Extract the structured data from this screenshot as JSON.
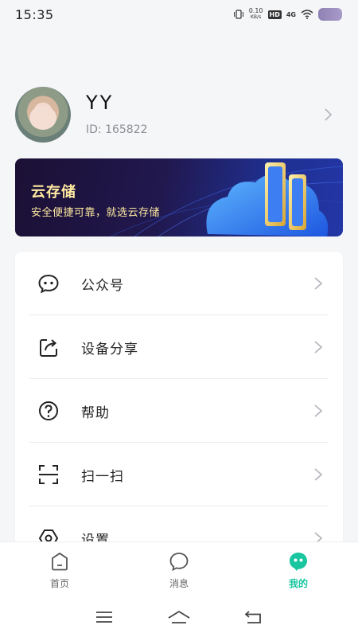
{
  "status_bar": {
    "time": "15:35",
    "net_speed": "0.10",
    "net_unit": "KB/s",
    "hd": "HD",
    "network": "4G"
  },
  "profile": {
    "name": "YY",
    "id_text": "ID: 165822"
  },
  "banner": {
    "title": "云存储",
    "subtitle": "安全便捷可靠，就选云存储"
  },
  "menu": {
    "items": [
      {
        "label": "公众号",
        "icon": "wechat-icon"
      },
      {
        "label": "设备分享",
        "icon": "share-icon"
      },
      {
        "label": "帮助",
        "icon": "help-icon"
      },
      {
        "label": "扫一扫",
        "icon": "scan-icon"
      },
      {
        "label": "设置",
        "icon": "settings-icon"
      }
    ]
  },
  "tabs": [
    {
      "label": "首页",
      "icon": "home-icon",
      "active": false
    },
    {
      "label": "消息",
      "icon": "message-icon",
      "active": false
    },
    {
      "label": "我的",
      "icon": "profile-icon",
      "active": true
    }
  ],
  "colors": {
    "accent": "#19c6a0",
    "banner_text": "#ffe9a0",
    "background": "#f5f6f8"
  }
}
